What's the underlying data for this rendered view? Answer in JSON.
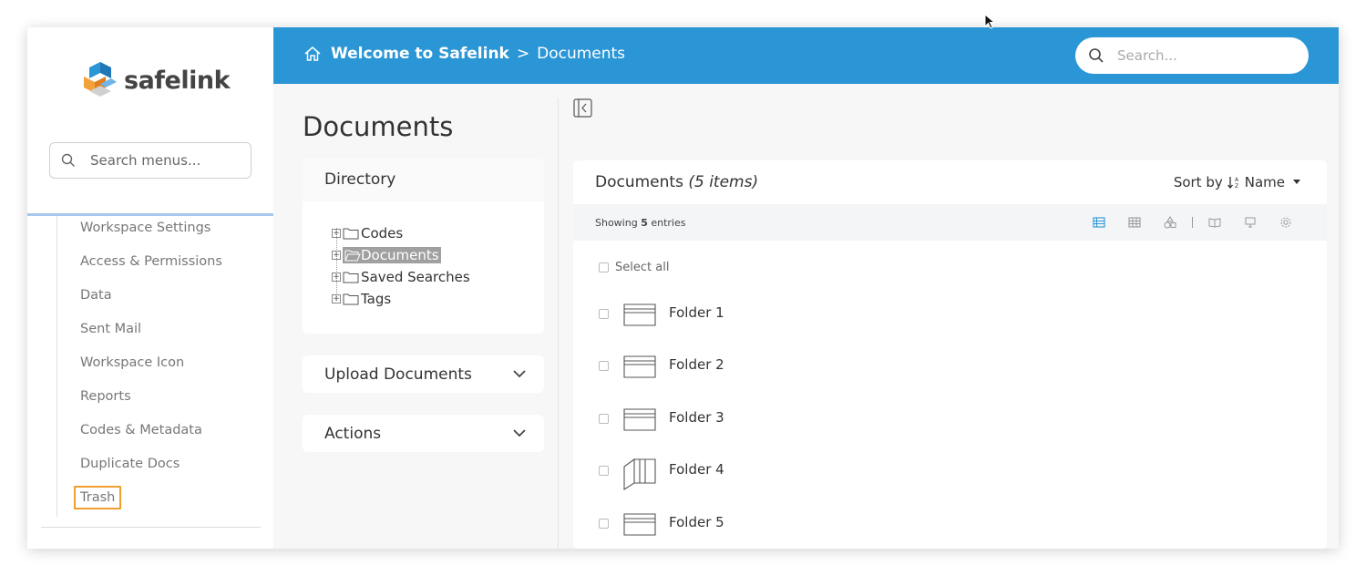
{
  "brand": {
    "name": "safelink"
  },
  "sidebar": {
    "search_placeholder": "Search menus...",
    "items": [
      {
        "label": "Workspace Settings"
      },
      {
        "label": "Access & Permissions"
      },
      {
        "label": "Data"
      },
      {
        "label": "Sent Mail"
      },
      {
        "label": "Workspace Icon"
      },
      {
        "label": "Reports"
      },
      {
        "label": "Codes & Metadata"
      },
      {
        "label": "Duplicate Docs"
      },
      {
        "label": "Trash",
        "highlighted": true
      }
    ]
  },
  "header": {
    "home": "Welcome to Safelink",
    "separator": ">",
    "current": "Documents",
    "search_placeholder": "Search...",
    "color": "#2b96d6"
  },
  "page": {
    "title": "Documents",
    "directory": {
      "title": "Directory",
      "tree": [
        {
          "label": "Codes",
          "selected": false
        },
        {
          "label": "Documents",
          "selected": true
        },
        {
          "label": "Saved Searches",
          "selected": false
        },
        {
          "label": "Tags",
          "selected": false
        }
      ]
    },
    "upload": {
      "title": "Upload Documents"
    },
    "actions": {
      "title": "Actions"
    }
  },
  "list": {
    "title": "Documents",
    "count_label": "(5 items)",
    "sort_prefix": "Sort by",
    "sort_field": "Name",
    "showing_prefix": "Showing",
    "showing_count": "5",
    "showing_suffix": "entries",
    "select_all": "Select all",
    "items": [
      {
        "name": "Folder 1",
        "icon": "folder-closed-icon"
      },
      {
        "name": "Folder 2",
        "icon": "folder-closed-icon"
      },
      {
        "name": "Folder 3",
        "icon": "folder-closed-icon"
      },
      {
        "name": "Folder 4",
        "icon": "folder-open-icon"
      },
      {
        "name": "Folder 5",
        "icon": "folder-closed-icon"
      }
    ],
    "active_view_color": "#2b96d6"
  }
}
